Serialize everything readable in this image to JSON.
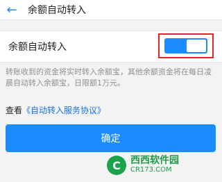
{
  "header": {
    "back_icon": "back-arrow-icon",
    "title": "余额自动转入"
  },
  "setting": {
    "label": "余额自动转入",
    "toggle_on": true,
    "highlight_color": "#e0262a",
    "accent_color": "#1a8cff"
  },
  "description": "转账收到的资金将实时转入余额宝，其他余额资金将在每日凌晨自动转入余额宝，日限额1万元。",
  "agreement": {
    "prefix": "查看",
    "link": "《自动转入服务协议》"
  },
  "confirm_button": "确定",
  "watermark": {
    "logo_icon": "site-logo-icon",
    "text": "西西软件园",
    "domain": "CR173.COM"
  }
}
